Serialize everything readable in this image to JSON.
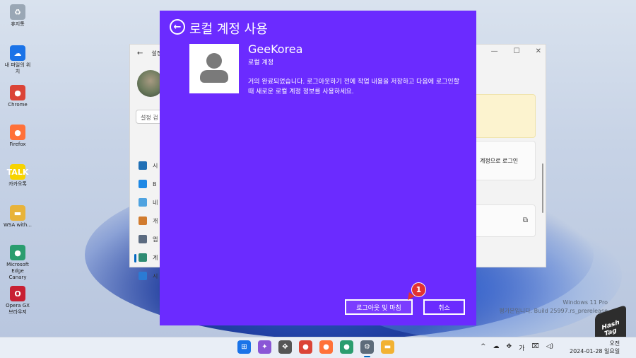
{
  "desktop": {
    "icons": [
      {
        "label": "휴지통",
        "color": "#9aa7b5",
        "glyph": "♻"
      },
      {
        "label": "내 파일의 위치",
        "color": "#1a73e8",
        "glyph": "☁"
      },
      {
        "label": "Chrome",
        "color": "#db4437",
        "glyph": "●"
      },
      {
        "label": "Firefox",
        "color": "#ff7139",
        "glyph": "●"
      },
      {
        "label": "카카오톡",
        "color": "#f7d300",
        "glyph": "TALK"
      },
      {
        "label": "WSA with...",
        "color": "#e8b33a",
        "glyph": "▬"
      },
      {
        "label": "Microsoft Edge Canary",
        "color": "#2a9d6f",
        "glyph": "●"
      },
      {
        "label": "Opera GX 브라우저",
        "color": "#c82033",
        "glyph": "O"
      }
    ]
  },
  "settings_window": {
    "title": "설정",
    "search_placeholder": "설정 검",
    "controls": [
      "—",
      "☐",
      "✕"
    ],
    "nav": [
      {
        "label": "시",
        "color": "#1f6fb5"
      },
      {
        "label": "B",
        "color": "#1e88e5"
      },
      {
        "label": "네",
        "color": "#4fa3e0"
      },
      {
        "label": "개",
        "color": "#d17b2e"
      },
      {
        "label": "앱",
        "color": "#5b6b80"
      },
      {
        "label": "계",
        "color": "#2e8b72",
        "active": true
      },
      {
        "label": "시",
        "color": "#2b7bd4"
      }
    ],
    "login_button": "계정으로 로그인"
  },
  "dialog": {
    "back_glyph": "←",
    "title": "로컬 계정 사용",
    "username": "GeeKorea",
    "account_type": "로컬 계정",
    "message": "거의 완료되었습니다. 로그아웃하기 전에 작업 내용을 저장하고 다음에 로그인할 때 새로운 로컬 계정 정보를 사용하세요.",
    "signout_button": "로그아웃 및 마침",
    "cancel_button": "취소",
    "step_badge": "1"
  },
  "watermark": {
    "line1": "Windows 11 Pro",
    "line2": "평가본입니다. Build 25997.rs_prerelease"
  },
  "logo": {
    "line1": "Hash",
    "line2": "Tag"
  },
  "taskbar": {
    "apps": [
      {
        "name": "start",
        "color": "#1a73e8",
        "glyph": "⊞"
      },
      {
        "name": "copilot",
        "color": "#8a56d6",
        "glyph": "✦"
      },
      {
        "name": "taskview",
        "color": "#555555",
        "glyph": "✥"
      },
      {
        "name": "chrome",
        "color": "#db4437",
        "glyph": "●"
      },
      {
        "name": "firefox",
        "color": "#ff7139",
        "glyph": "●"
      },
      {
        "name": "edge",
        "color": "#2a9d6f",
        "glyph": "●"
      },
      {
        "name": "settings",
        "color": "#5d6b7a",
        "glyph": "⚙",
        "active": true
      },
      {
        "name": "explorer",
        "color": "#f2b233",
        "glyph": "▬"
      }
    ],
    "tray": [
      "^",
      "☁",
      "✥",
      "가",
      "⌧",
      "◁)"
    ],
    "clock_time": "오전",
    "clock_date": "2024-01-28 일요일"
  }
}
